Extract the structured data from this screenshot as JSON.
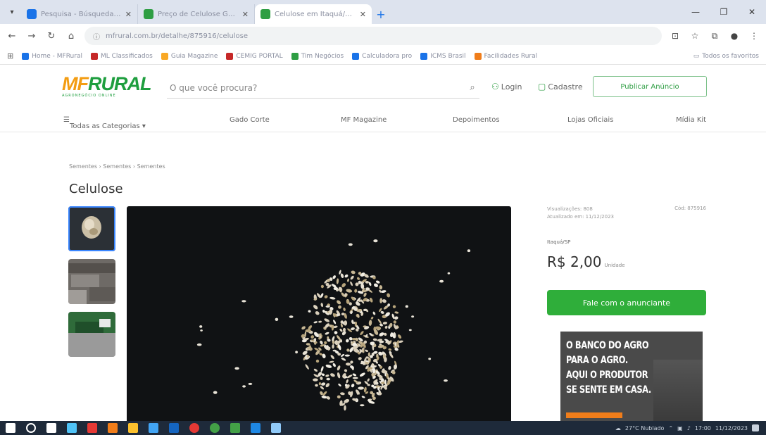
{
  "browser": {
    "tabs": [
      {
        "title": "Pesquisa - Búsqueda - Google",
        "favicon_color": "#1a73e8"
      },
      {
        "title": "Preço de Celulose Granulada",
        "favicon_color": "#2e9e43"
      },
      {
        "title": "Celulose em Itaquá/SP - MFRural",
        "favicon_color": "#2e9e43",
        "active": true
      }
    ],
    "url": "mfrural.com.br/detalhe/875916/celulose",
    "bookmarks": [
      {
        "label": "Home - MFRural",
        "color": "#1a73e8"
      },
      {
        "label": "ML Classificados",
        "color": "#c62828"
      },
      {
        "label": "Guia Magazine",
        "color": "#f9a825"
      },
      {
        "label": "CEMIG PORTAL",
        "color": "#c62828"
      },
      {
        "label": "Tim Negócios",
        "color": "#2e9e43"
      },
      {
        "label": "Calculadora pro",
        "color": "#1a73e8"
      },
      {
        "label": "ICMS Brasil",
        "color": "#1a73e8"
      },
      {
        "label": "Facilidades Rural",
        "color": "#f07d1a"
      }
    ],
    "all_bookmarks_label": "Todos os favoritos"
  },
  "header": {
    "logo_mf": "MF",
    "logo_rural": "RURAL",
    "logo_tagline": "AGRONEGÓCIO ONLINE",
    "search_placeholder": "O que você procura?",
    "login_label": "Login",
    "signup_label": "Cadastre",
    "publish_label": "Publicar Anúncio"
  },
  "category_nav": {
    "all_categories": "Todas as Categorias ▾",
    "items": [
      "Gado Corte",
      "MF Magazine",
      "Depoimentos",
      "Lojas Oficiais",
      "Mídia Kit"
    ]
  },
  "product": {
    "breadcrumb": "Sementes › Sementes › Sementes",
    "title": "Celulose",
    "views": "Visualizações: 808",
    "updated": "Atualizado em: 11/12/2023",
    "code": "Cód: 875916",
    "seller_location": "Itaquá/SP",
    "price": "R$ 2,00",
    "price_unit": "Unidade",
    "contact_label": "Fale com o anunciante"
  },
  "ad": {
    "lines": [
      "O BANCO DO AGRO",
      "PARA O AGRO.",
      "AQUI O PRODUTOR",
      "SE SENTE EM CASA."
    ]
  },
  "taskbar": {
    "icons": [
      "#ffffff",
      "#ffffff",
      "#ffffff",
      "#4fc3f7",
      "#e53935",
      "#f07d1a",
      "#fbc02d",
      "#42a5f5",
      "#1565c0",
      "#e53935",
      "#43a047",
      "#43a047",
      "#1e88e5",
      "#90caf9"
    ],
    "weather": "27°C Nublado",
    "time": "17:00",
    "date": "11/12/2023"
  },
  "colors": {
    "brand_green": "#2fae3a",
    "brand_orange": "#f39c12"
  }
}
